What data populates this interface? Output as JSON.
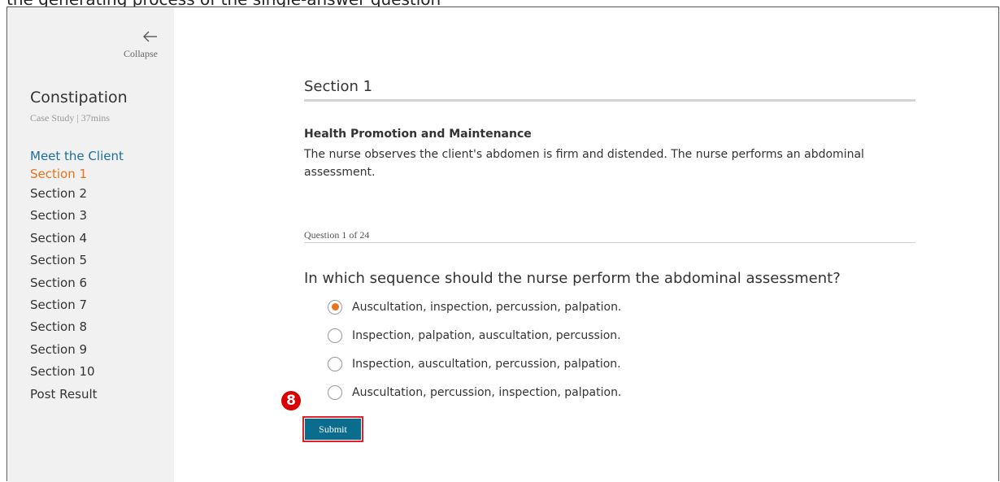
{
  "top_caption": "the generating process of the single-answer question",
  "sidebar": {
    "collapse_label": "Collapse",
    "course_title": "Constipation",
    "course_meta": "Case Study | 37mins",
    "nav_items": [
      {
        "label": "Meet the Client",
        "state": "link"
      },
      {
        "label": "Section 1",
        "state": "active"
      },
      {
        "label": "Section 2",
        "state": "default"
      },
      {
        "label": "Section 3",
        "state": "default"
      },
      {
        "label": "Section 4",
        "state": "default"
      },
      {
        "label": "Section 5",
        "state": "default"
      },
      {
        "label": "Section 6",
        "state": "default"
      },
      {
        "label": "Section 7",
        "state": "default"
      },
      {
        "label": "Section 8",
        "state": "default"
      },
      {
        "label": "Section 9",
        "state": "default"
      },
      {
        "label": "Section 10",
        "state": "default"
      },
      {
        "label": "Post Result",
        "state": "default"
      }
    ]
  },
  "main": {
    "section_title": "Section 1",
    "content_heading": "Health Promotion and Maintenance",
    "content_body": "The nurse observes the client's abdomen is firm and distended. The nurse performs an abdominal assessment.",
    "question_counter": "Question 1 of 24",
    "question_text": "In which sequence should the nurse perform the abdominal assessment?",
    "options": [
      {
        "label": "Auscultation, inspection, percussion, palpation.",
        "selected": true
      },
      {
        "label": "Inspection, palpation, auscultation, percussion.",
        "selected": false
      },
      {
        "label": "Inspection, auscultation, percussion, palpation.",
        "selected": false
      },
      {
        "label": "Auscultation, percussion, inspection, palpation.",
        "selected": false
      }
    ],
    "step_badge": "8",
    "submit_label": "Submit"
  },
  "colors": {
    "accent_orange": "#e8731c",
    "link_blue": "#1a6fa0",
    "submit_teal": "#0b6d8e",
    "annotation_red": "#d80000"
  },
  "icons": {
    "collapse": "arrow-left-icon"
  }
}
